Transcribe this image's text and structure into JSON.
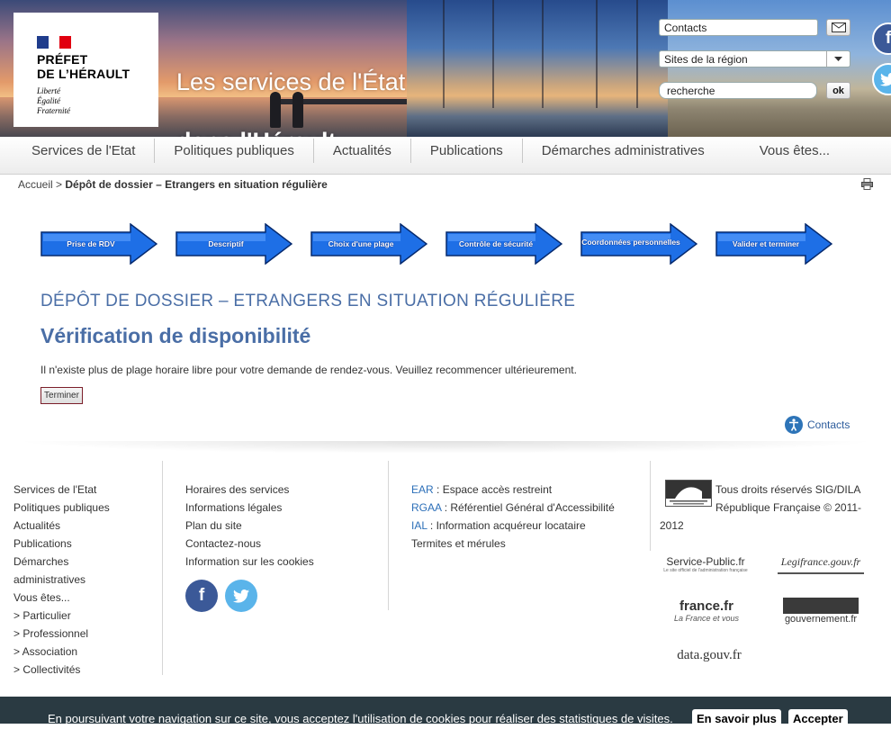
{
  "header": {
    "logo_title": "PRÉFET\nDE L’HÉRAULT",
    "logo_motto": "Liberté\nÉgalité\nFraternité",
    "site_title_line1": "Les services de l'État",
    "site_title_line2": "dans l'Hérault",
    "contacts_field": "Contacts",
    "region_select": "Sites de la région",
    "search_field": "recherche",
    "search_button": "ok"
  },
  "nav": {
    "items": [
      "Services de l'Etat",
      "Politiques publiques",
      "Actualités",
      "Publications",
      "Démarches administratives",
      "Vous êtes..."
    ]
  },
  "breadcrumb": {
    "home": "Accueil",
    "separator": ">",
    "current": "Dépôt de dossier – Etrangers en situation régulière"
  },
  "steps": [
    "Prise de RDV",
    "Descriptif",
    "Choix d'une plage",
    "Contrôle de sécurité",
    "Coordonnées personnelles",
    "Valider et terminer"
  ],
  "content": {
    "page_heading": "DÉPÔT DE DOSSIER – ETRANGERS EN SITUATION RÉGULIÈRE",
    "sub_heading": "Vérification de disponibilité",
    "message": "Il n'existe plus de plage horaire libre pour votre demande de rendez-vous. Veuillez recommencer ultérieurement.",
    "end_button": "Terminer",
    "contacts_link": "Contacts"
  },
  "footer": {
    "col1": [
      "Services de l'Etat",
      "Politiques publiques",
      "Actualités",
      "Publications",
      "Démarches",
      "administratives",
      "Vous êtes...",
      "> Particulier",
      "> Professionnel",
      "> Association",
      "> Collectivités"
    ],
    "col2": [
      "Horaires des services",
      "Informations légales",
      "Plan du site",
      "Contactez-nous",
      "Information sur les cookies"
    ],
    "col3": [
      {
        "acronym": "EAR",
        "text": " : Espace accès restreint"
      },
      {
        "acronym": "RGAA",
        "text": " : Référentiel Général d'Accessibilité"
      },
      {
        "acronym": "IAL",
        "text": " : Information acquéreur locataire"
      },
      {
        "acronym": "",
        "text": "Termites et mérules"
      }
    ],
    "rights": "Tous droits réservés SIG/DILA République Française © 2011-2012",
    "partners": [
      "Service-Public.fr",
      "Legifrance.gouv.fr",
      "france.fr",
      "gouvernement.fr",
      "data.gouv.fr"
    ],
    "partner_taglines": {
      "service_public": "Le site officiel de l'administration française",
      "france_fr": "La France et vous"
    }
  },
  "cookie": {
    "text": "En poursuivant votre navigation sur ce site, vous acceptez l'utilisation de cookies pour réaliser des statistiques de visites.",
    "more_button": "En savoir plus",
    "accept_button": "Accepter"
  },
  "colors": {
    "heading_blue": "#4a6ea6",
    "step_blue": "#1e6fe6",
    "facebook": "#3b5998",
    "twitter": "#5ab4ea",
    "cookie_bar": "#2a3a42"
  }
}
